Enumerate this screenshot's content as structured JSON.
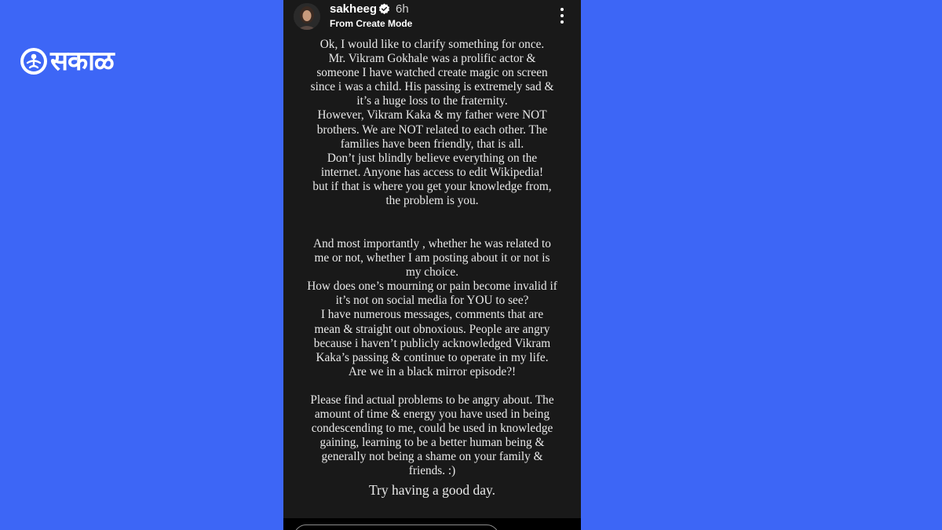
{
  "brand": {
    "logo_text": "सकाळ"
  },
  "story": {
    "username": "sakheeg",
    "time_ago": "6h",
    "subtitle": "From Create Mode",
    "paragraph_1": "Ok, I would like to clarify something for once.\nMr. Vikram Gokhale was a prolific actor &\nsomeone I have watched create magic on screen\nsince i was a child. His passing is extremely sad &\nit’s a huge loss to the fraternity.\nHowever, Vikram Kaka & my father were NOT\nbrothers. We are NOT related to each other. The\nfamilies have been friendly, that is all.\nDon’t just blindly believe everything on the\ninternet. Anyone has access to edit Wikipedia!\nbut if that is where you get your knowledge from,\nthe problem is you.",
    "paragraph_2": "And most importantly , whether he was related to\nme or not, whether I am posting about it or not is\nmy choice.\nHow does one’s mourning or pain become invalid if\nit’s not on social media for YOU to see?\nI have numerous messages, comments that are\nmean & straight out obnoxious. People are angry\nbecause i haven’t publicly acknowledged Vikram\nKaka’s passing & continue to operate in my life.\nAre we in a black mirror episode?!",
    "paragraph_3": "Please find actual problems to be angry about. The\namount of time & energy you have used in being\ncondescending to me, could be used in knowledge\ngaining, learning to be a better human being &\ngenerally not being a shame on your family &\nfriends. :)",
    "closing": "Try having a good day."
  },
  "colors": {
    "background": "#3d66f6",
    "story_background": "#191919",
    "text": "#e9e9e9"
  },
  "icons": {
    "verified": "verified-badge-icon",
    "more": "more-vertical-icon",
    "brand": "sakal-emblem-icon"
  }
}
